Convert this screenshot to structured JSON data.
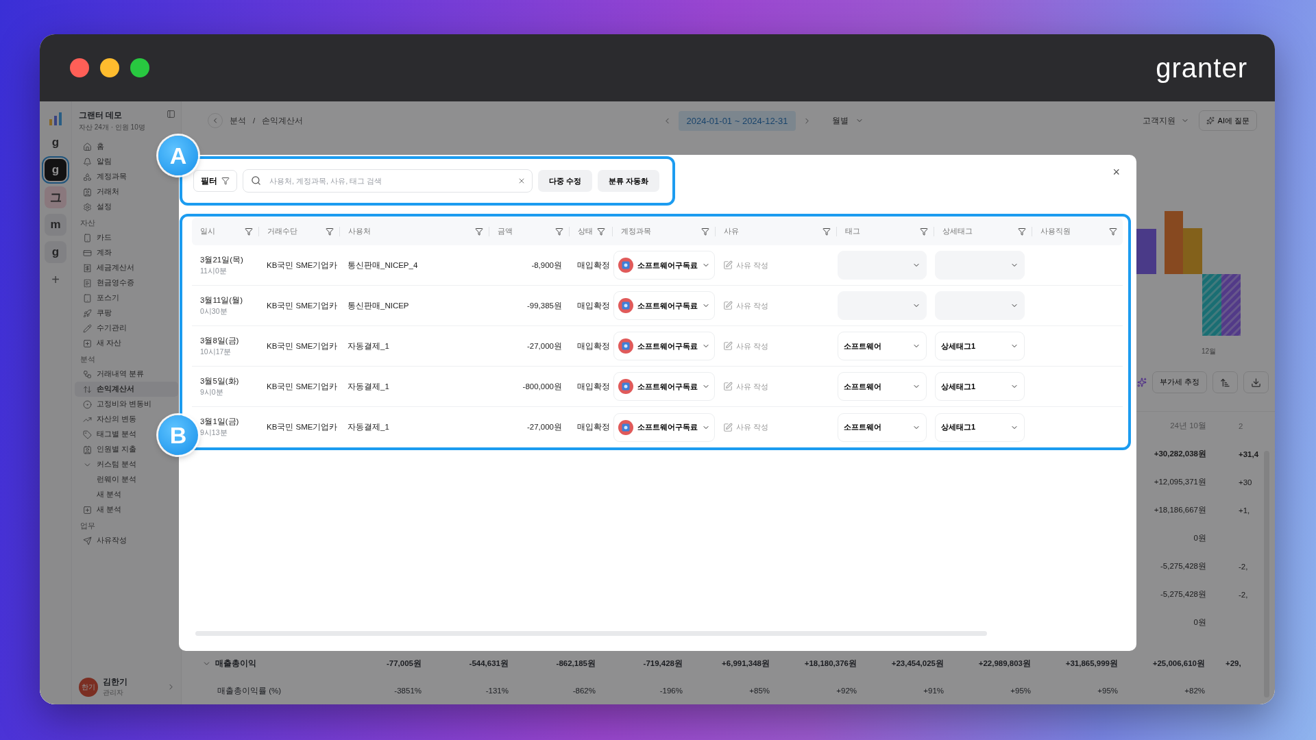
{
  "window": {
    "logo": "granter"
  },
  "workspaces": [
    {
      "label": "g",
      "selected": false,
      "kind": "plain"
    },
    {
      "label": "g",
      "selected": true,
      "kind": "plain"
    },
    {
      "label": "그",
      "selected": false,
      "kind": "accent"
    },
    {
      "label": "m",
      "selected": false,
      "kind": "muted"
    },
    {
      "label": "g",
      "selected": false,
      "kind": "muted"
    }
  ],
  "add_workspace": "+",
  "org": {
    "name": "그랜터 데모",
    "meta": "자산 24개 · 인원 10명"
  },
  "sections": [
    {
      "items": [
        {
          "label": "홈",
          "selected": false
        },
        {
          "label": "알림",
          "selected": false
        },
        {
          "label": "계정과목",
          "selected": false
        },
        {
          "label": "거래처",
          "selected": false
        },
        {
          "label": "설정",
          "selected": false
        }
      ]
    },
    {
      "title": "자산",
      "items": [
        {
          "label": "카드",
          "selected": false
        },
        {
          "label": "계좌",
          "selected": false
        },
        {
          "label": "세금계산서",
          "selected": false
        },
        {
          "label": "현금영수증",
          "selected": false
        },
        {
          "label": "포스기",
          "selected": false
        },
        {
          "label": "쿠팡",
          "selected": false
        },
        {
          "label": "수기관리",
          "selected": false
        },
        {
          "label": "새 자산",
          "selected": false
        }
      ]
    },
    {
      "title": "분석",
      "items": [
        {
          "label": "거래내역 분류",
          "selected": false
        },
        {
          "label": "손익계산서",
          "selected": true
        },
        {
          "label": "고정비와 변동비",
          "selected": false
        },
        {
          "label": "자산의 변동",
          "selected": false
        },
        {
          "label": "태그별 분석",
          "selected": false
        },
        {
          "label": "인원별 지출",
          "selected": false
        },
        {
          "label": "커스텀 분석",
          "selected": false,
          "expanded": true,
          "children": [
            {
              "label": "런웨이 분석",
              "selected": false
            },
            {
              "label": "새 분석",
              "selected": false
            }
          ]
        },
        {
          "label": "새 분석",
          "selected": false
        }
      ]
    },
    {
      "title": "업무",
      "items": [
        {
          "label": "사유작성",
          "selected": false
        }
      ]
    }
  ],
  "user": {
    "avatar": "한기",
    "name": "김한기",
    "role": "관리자"
  },
  "topbar": {
    "breadcrumb": [
      "분석",
      "손익계산서"
    ],
    "separator": "/",
    "date_range": "2024-01-01 ~ 2024-12-31",
    "period": "월별",
    "support": "고객지원",
    "ai_button": "AI에 질문"
  },
  "report": {
    "chart_label": "12월",
    "vat_button": "부가세 추정",
    "column_header": "24년 10월",
    "next_column_header": "2",
    "values": [
      {
        "value": "+30,282,038원",
        "strong": true,
        "next": "+31,4"
      },
      {
        "value": "+12,095,371원",
        "strong": false,
        "next": "+30"
      },
      {
        "value": "+18,186,667원",
        "strong": false,
        "next": "+1,"
      },
      {
        "value": "0원",
        "strong": false
      },
      {
        "value": "-5,275,428원",
        "strong": false,
        "next": "-2,"
      },
      {
        "value": "-5,275,428원",
        "strong": false,
        "next": "-2,"
      },
      {
        "value": "0원",
        "strong": false
      }
    ],
    "bottom_rows": [
      {
        "kind": "group",
        "expanded": true,
        "label": "매출총이익",
        "values": [
          "-77,005원",
          "-544,631원",
          "-862,185원",
          "-719,428원",
          "+6,991,348원",
          "+18,180,376원",
          "+23,454,025원",
          "+22,989,803원",
          "+31,865,999원",
          "+25,006,610원",
          "+29,"
        ]
      },
      {
        "kind": "item",
        "label": "매출총이익률 (%)",
        "values": [
          "-3851%",
          "-131%",
          "-862%",
          "-196%",
          "+85%",
          "+92%",
          "+91%",
          "+95%",
          "+95%",
          "+82%"
        ]
      }
    ]
  },
  "modal": {
    "close": "×",
    "toolbar": {
      "callout": "A",
      "filter": "필터",
      "search_placeholder": "사용처, 계정과목, 사유, 태그 검색",
      "buttons": [
        "다중 수정",
        "분류 자동화"
      ]
    },
    "table": {
      "callout": "B",
      "columns": [
        "일시",
        "거래수단",
        "사용처",
        "금액",
        "상태",
        "계정과목",
        "사유",
        "태그",
        "상세태그",
        "사용직원"
      ],
      "rows": [
        {
          "date": "3월21일(목)",
          "time": "11시0분",
          "method": "KB국민 SME기업카",
          "merchant": "통신판매_NICEP_4",
          "amount": "-8,900원",
          "status": "매입확정",
          "account": "소프트웨어구독료",
          "reason": "사유 작성"
        },
        {
          "date": "3월11일(월)",
          "time": "0시30분",
          "method": "KB국민 SME기업카",
          "merchant": "통신판매_NICEP",
          "amount": "-99,385원",
          "status": "매입확정",
          "account": "소프트웨어구독료",
          "reason": "사유 작성"
        },
        {
          "date": "3월8일(금)",
          "time": "10시17분",
          "method": "KB국민 SME기업카",
          "merchant": "자동결제_1",
          "amount": "-27,000원",
          "status": "매입확정",
          "account": "소프트웨어구독료",
          "reason": "사유 작성",
          "tag": "소프트웨어",
          "detail_tag": "상세태그1"
        },
        {
          "date": "3월5일(화)",
          "time": "9시0분",
          "method": "KB국민 SME기업카",
          "merchant": "자동결제_1",
          "amount": "-800,000원",
          "status": "매입확정",
          "account": "소프트웨어구독료",
          "reason": "사유 작성",
          "tag": "소프트웨어",
          "detail_tag": "상세태그1"
        },
        {
          "date": "3월1일(금)",
          "time": "9시13분",
          "method": "KB국민 SME기업카",
          "merchant": "자동결제_1",
          "amount": "-27,000원",
          "status": "매입확정",
          "account": "소프트웨어구독료",
          "reason": "사유 작성",
          "tag": "소프트웨어",
          "detail_tag": "상세태그1"
        }
      ]
    }
  }
}
